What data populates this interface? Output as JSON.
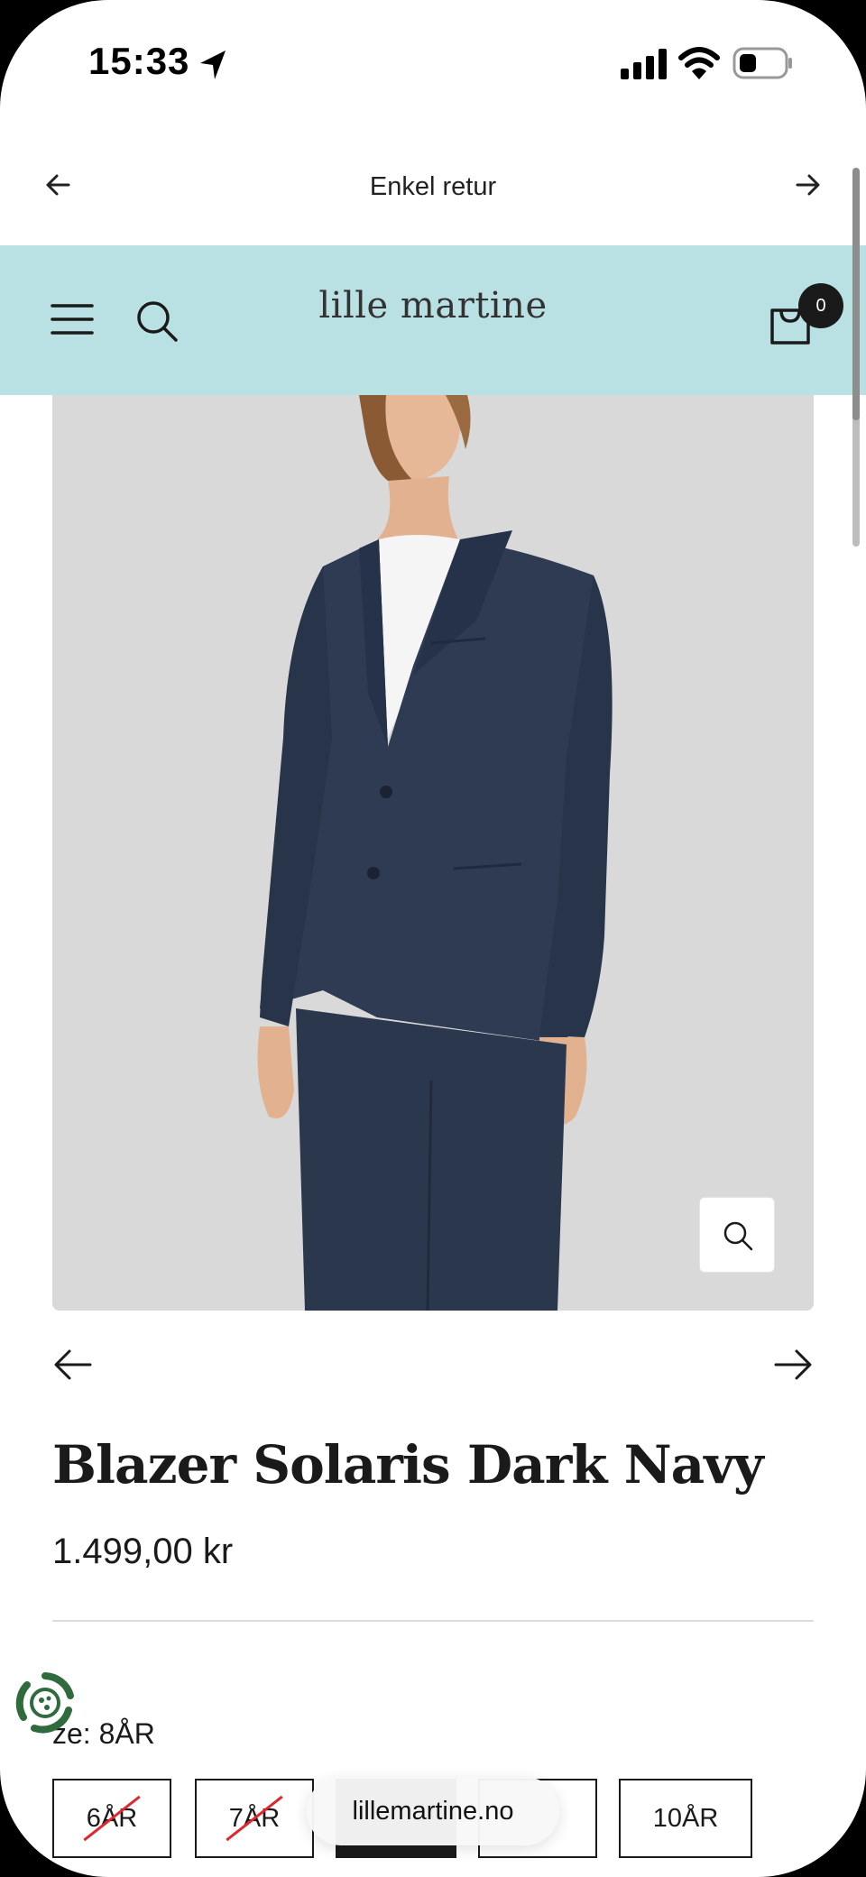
{
  "status_bar": {
    "time": "15:33"
  },
  "announcement": {
    "text": "Enkel retur"
  },
  "header": {
    "logo": "lille martine",
    "cart_count": "0"
  },
  "product": {
    "title": "Blazer Solaris Dark Navy",
    "price": "1.499,00 kr",
    "size_label": "ze: 8ÅR",
    "sizes": [
      {
        "label": "6ÅR",
        "available": false
      },
      {
        "label": "7ÅR",
        "available": false
      },
      {
        "label": "",
        "available": true
      },
      {
        "label": "",
        "available": true
      },
      {
        "label": "10ÅR",
        "available": true
      }
    ]
  },
  "browser": {
    "url": "lillemartine.no"
  },
  "colors": {
    "header_bg": "#b9e0e2",
    "text": "#1a1a1a",
    "strike": "#e0262e",
    "image_bg": "#d9d9d9"
  }
}
